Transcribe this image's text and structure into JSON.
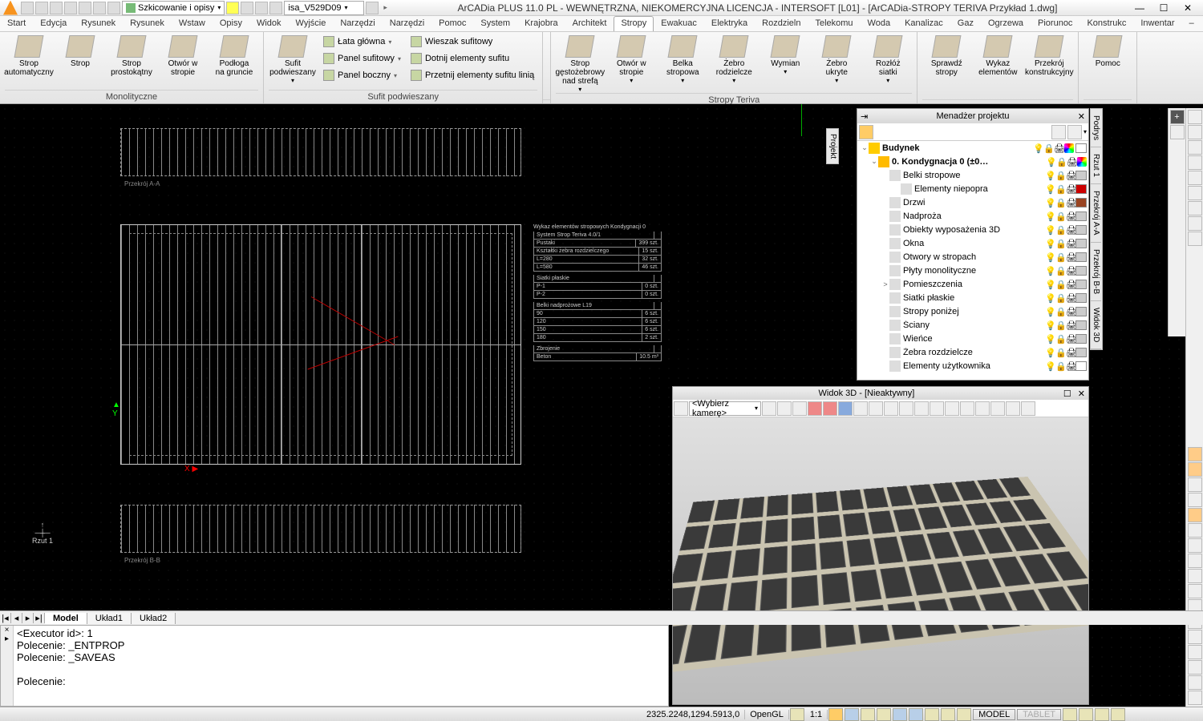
{
  "titlebar": {
    "combo1": "Szkicowanie i opisy",
    "combo2": "isa_V529D09",
    "title": "ArCADia PLUS 11.0 PL - WEWNĘTRZNA, NIEKOMERCYJNA LICENCJA - INTERSOFT [L01] - [ArCADia-STROPY TERIVA Przykład 1.dwg]",
    "min": "—",
    "max": "☐",
    "close": "✕"
  },
  "tabs": [
    "Start",
    "Edycja",
    "Rysunek",
    "Rysunek",
    "Wstaw",
    "Opisy",
    "Widok",
    "Wyjście",
    "Narzędzi",
    "Narzędzi",
    "Pomoc",
    "System",
    "Krajobra",
    "Architekt",
    "Stropy",
    "Ewakuac",
    "Elektryka",
    "Rozdzieln",
    "Telekomu",
    "Woda",
    "Kanalizac",
    "Gaz",
    "Ogrzewa",
    "Piorunoc",
    "Konstrukc",
    "Inwentar"
  ],
  "tabs_active": 14,
  "ribbon": {
    "g1": {
      "label": "Monolityczne",
      "btns": [
        "Strop\nautomatyczny",
        "Strop",
        "Strop\nprostokątny",
        "Otwór w\nstropie",
        "Podłoga\nna gruncie"
      ]
    },
    "g2": {
      "label": "Sufit podwieszany",
      "big": "Sufit\npodwieszany",
      "rows": [
        [
          "Łata główna",
          "Wieszak sufitowy"
        ],
        [
          "Panel sufitowy",
          "Dotnij elementy sufitu"
        ],
        [
          "Panel boczny",
          "Przetnij elementy sufitu linią"
        ]
      ]
    },
    "g3": {
      "label": "Stropy Teriva",
      "btns": [
        "Strop gęstożebrowy\nnad strefą",
        "Otwór w\nstropie",
        "Belka\nstropowa",
        "Żebro\nrodzielcze",
        "Wymian",
        "Żebro\nukryte",
        "Rozłóż\nsiatki"
      ]
    },
    "g4": {
      "btns": [
        "Sprawdź\nstropy",
        "Wykaz\nelementów",
        "Przekrój\nkonstrukcyjny"
      ]
    },
    "g5": {
      "btns": [
        "Pomoc"
      ]
    }
  },
  "pm": {
    "title": "Menadżer projektu",
    "root": "Budynek",
    "level": "0. Kondygnacja 0 (±0…",
    "nodes": [
      {
        "n": "Belki stropowe",
        "sw": "#cccccc"
      },
      {
        "n": "Elementy niepopra",
        "sw": "#cc0000",
        "indent": 1
      },
      {
        "n": "Drzwi",
        "sw": "#994422"
      },
      {
        "n": "Nadproża",
        "sw": "#cccccc"
      },
      {
        "n": "Obiekty wyposażenia 3D",
        "sw": "#cccccc"
      },
      {
        "n": "Okna",
        "sw": "#cccccc"
      },
      {
        "n": "Otwory w stropach",
        "sw": "#cccccc"
      },
      {
        "n": "Płyty monolityczne",
        "sw": "#cccccc"
      },
      {
        "n": "Pomieszczenia",
        "sw": "#cccccc",
        "tw": ">"
      },
      {
        "n": "Siatki płaskie",
        "sw": "#cccccc"
      },
      {
        "n": "Stropy poniżej",
        "sw": "#cccccc"
      },
      {
        "n": "Ściany",
        "sw": "#cccccc"
      },
      {
        "n": "Wieńce",
        "sw": "#cccccc"
      },
      {
        "n": "Żebra rozdzielcze",
        "sw": "#cccccc"
      },
      {
        "n": "Elementy użytkownika",
        "sw": "#ffffff"
      }
    ]
  },
  "sidetabs": [
    "Podrys",
    "Rzut 1",
    "Przekrój A-A",
    "Przekrój B-B",
    "Widok 3D"
  ],
  "proj_tab": "Projekt",
  "v3d": {
    "title": "Widok 3D - [Nieaktywny]",
    "camera": "<Wybierz kamerę>"
  },
  "mtabs": {
    "items": [
      "Model",
      "Układ1",
      "Układ2"
    ],
    "active": 0
  },
  "cmd": {
    "l1": "<Executor id>: 1",
    "l2": "Polecenie: _ENTPROP",
    "l3": "Polecenie: _SAVEAS",
    "prompt": "Polecenie:"
  },
  "status": {
    "coords": "2325.2248,1294.5913,0",
    "opengl": "OpenGL",
    "ratio": "1:1",
    "model": "MODEL",
    "tablet": "TABLET"
  },
  "canvas": {
    "seclblA": "Przekrój A-A",
    "seclblB": "Przekrój B-B",
    "rzut": "Rzut 1",
    "tabletitle": "Wykaz elementów stropowych Kondygnacji 0",
    "y": "Y",
    "x": "X"
  }
}
